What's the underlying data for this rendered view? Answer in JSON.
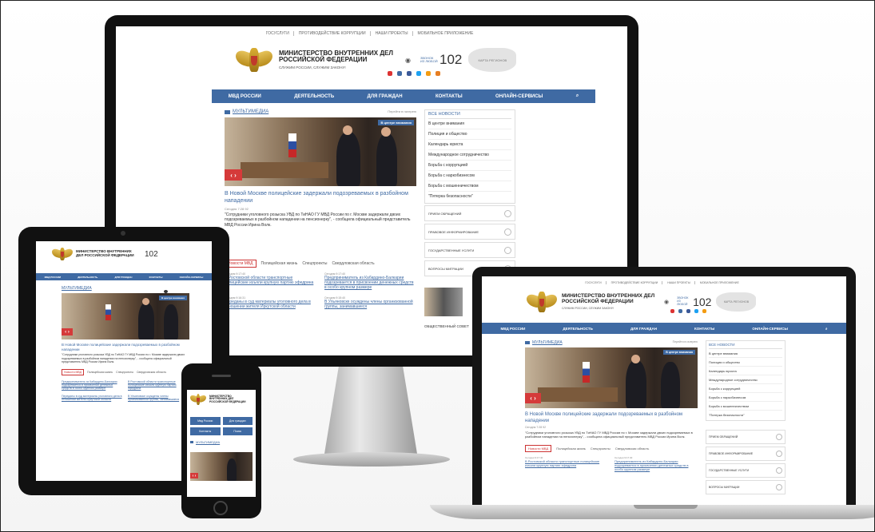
{
  "site": {
    "top_links": [
      "ГОСУСЛУГИ",
      "ПРОТИВОДЕЙСТВИЕ КОРРУПЦИИ",
      "НАШИ ПРОЕКТЫ",
      "МОБИЛЬНОЕ ПРИЛОЖЕНИЕ"
    ],
    "ministry_name": "МИНИСТЕРСТВО ВНУТРЕННИХ ДЕЛ РОССИЙСКОЙ ФЕДЕРАЦИИ",
    "motto": "СЛУЖИМ РОССИИ, СЛУЖИМ ЗАКОНУ!",
    "phone_label": "ЗВОНОК ИЗ ЛЮБОЙ",
    "phone_number": "102",
    "map_label": "КАРТА РЕГИОНОВ",
    "nav": [
      "МВД РОССИИ",
      "ДЕЯТЕЛЬНОСТЬ",
      "ДЛЯ ГРАЖДАН",
      "КОНТАКТЫ",
      "ОНЛАЙН-СЕРВИСЫ"
    ],
    "multimedia_title": "МУЛЬТИМЕДИА",
    "multimedia_more": "Перейти в галерею",
    "slider_badge": "В центре внимания",
    "headline": "В Новой Москве полицейские задержали подозреваемых в разбойном нападении",
    "headline_meta": "Сегодня 7:28 92",
    "lead": "\"Сотрудники уголовного розыска УВД по ТиНАО ГУ МВД России по г. Москве задержали двоих подозреваемых в разбойном нападении на пенсионерку\", - сообщила официальный представитель МВД России Ирина Волк.",
    "all_news_title": "ВСЕ НОВОСТИ",
    "all_news": [
      "В центре внимания",
      "Полиция и общество",
      "Календарь юриста",
      "Международное сотрудничество",
      "Борьба с коррупцией",
      "Борьба с наркобизнесом",
      "Борьба с мошенничеством",
      "\"Пятерка безопасности\""
    ],
    "services": [
      "ПРИЕМ ОБРАЩЕНИЙ",
      "ПРАВОВОЕ ИНФОРМИРОВАНИЕ",
      "ГОСУДАРСТВЕННЫЕ УСЛУГИ",
      "ВОПРОСЫ МИГРАЦИИ"
    ],
    "tabs": [
      "Новости МВД",
      "Полицейская жизнь",
      "Спецпроекты",
      "Свердловская область"
    ],
    "news_items": [
      {
        "meta": "Сегодня 9:17:40",
        "title": "В Ростовской области транспортные полицейские изъяли крупную партию эфедрина"
      },
      {
        "meta": "Сегодня 9:17:40",
        "title": "Предприниматель из Кабардино-Балкарии подозревается в присвоении денежных средств в особо крупном размере"
      },
      {
        "meta": "Сегодня 9:16:31",
        "title": "Переданы в суд материалы уголовного дела в отношении жителя Иркутской области"
      },
      {
        "meta": "Сегодня 9:15:40",
        "title": "В Ульяновске осуждены члены организованной группы, занимавшиеся"
      }
    ],
    "public_council": "ОБЩЕСТВЕННЫЙ СОВЕТ"
  },
  "mobile": {
    "ministry_name": "МИНИСТЕРСТВО ВНУТРЕННИХ ДЕЛ РОССИЙСКОЙ ФЕДЕРАЦИИ",
    "buttons": [
      "Мвд России",
      "Для граждан",
      "Контакты",
      "Поиск"
    ]
  },
  "colors": {
    "nav_blue": "#3f6aa3",
    "accent_red": "#d53a3a",
    "emblem_gold": "#d9ad34"
  }
}
